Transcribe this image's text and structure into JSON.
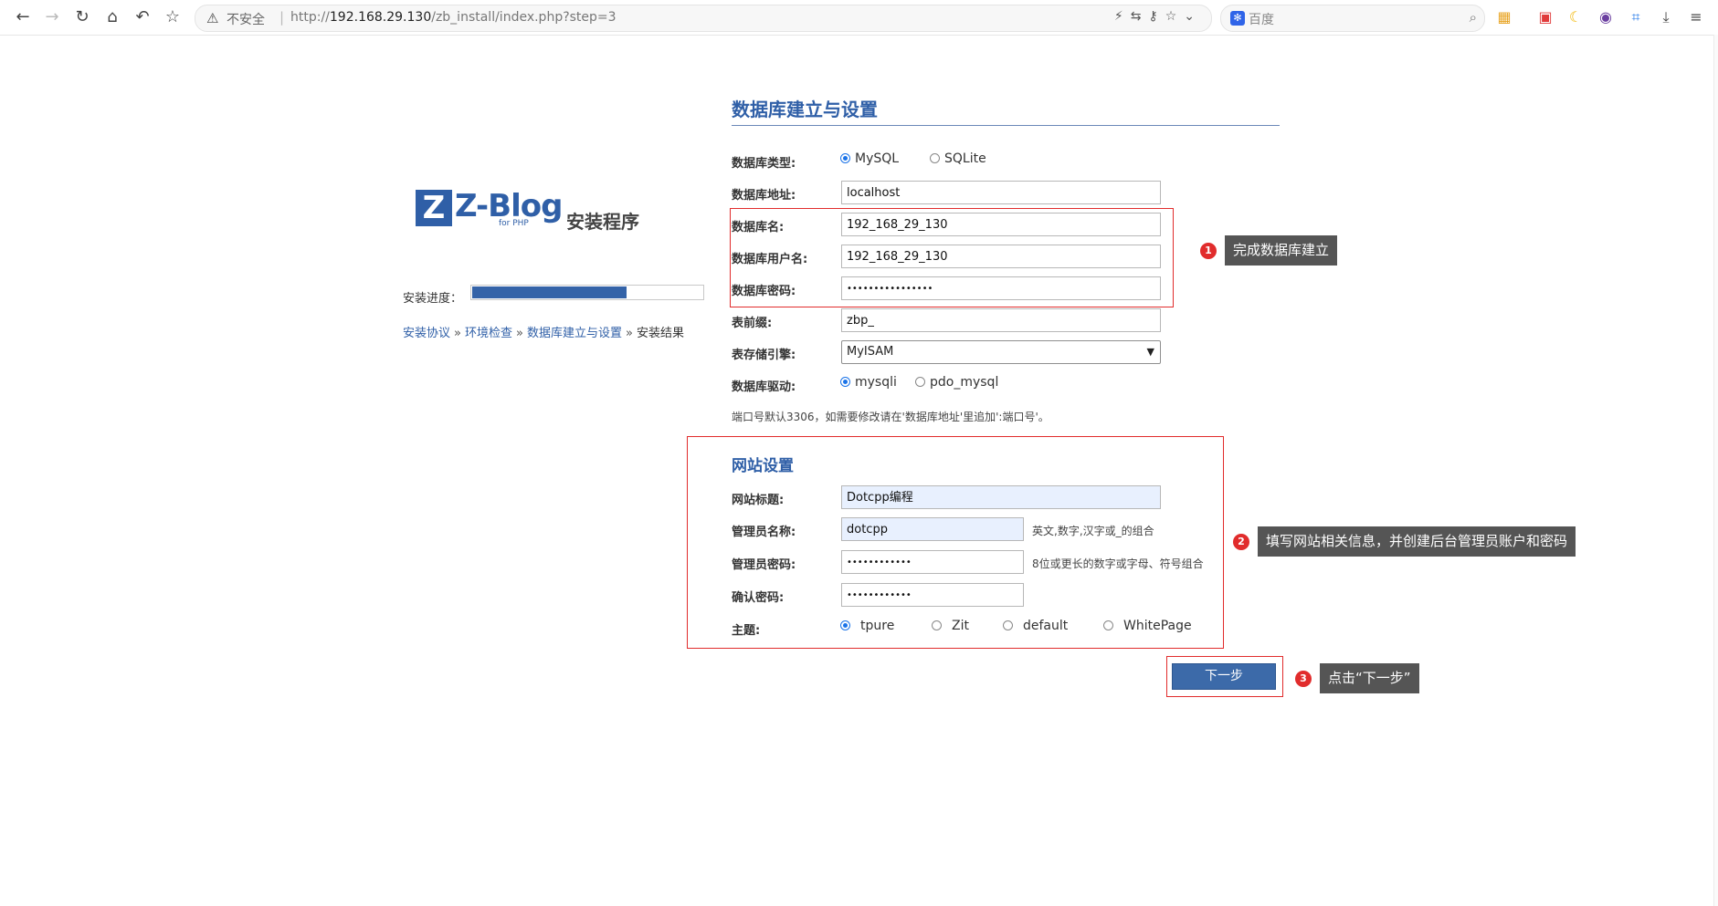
{
  "browser": {
    "insecure_label": "不安全",
    "url_prefix": "http://",
    "url_host": "192.168.29.130",
    "url_path": "/zb_install/index.php?step=3",
    "search_placeholder": "百度"
  },
  "brand": {
    "logo_letter": "Z",
    "logo_word": "Z-Blog",
    "logo_sub": "for PHP",
    "installer_label": "安装程序"
  },
  "progress": {
    "label": "安装进度：",
    "fraction": 0.67
  },
  "steps": {
    "items": [
      "安装协议",
      "环境检查",
      "数据库建立与设置",
      "安装结果"
    ],
    "separator": "»"
  },
  "db": {
    "heading": "数据库建立与设置",
    "type_label": "数据库类型:",
    "type_options": [
      "MySQL",
      "SQLite"
    ],
    "host_label": "数据库地址:",
    "host_value": "localhost",
    "name_label": "数据库名:",
    "name_value": "192_168_29_130",
    "user_label": "数据库用户名:",
    "user_value": "192_168_29_130",
    "password_label": "数据库密码:",
    "password_value": "••••••••••••••••",
    "prefix_label": "表前缀:",
    "prefix_value": "zbp_",
    "engine_label": "表存储引擎:",
    "engine_value": "MyISAM",
    "driver_label": "数据库驱动:",
    "driver_options": [
      "mysqli",
      "pdo_mysql"
    ],
    "port_note": "端口号默认3306，如需要修改请在'数据库地址'里追加':端口号'。"
  },
  "site": {
    "heading": "网站设置",
    "title_label": "网站标题:",
    "title_value": "Dotcpp编程",
    "admin_label": "管理员名称:",
    "admin_value": "dotcpp",
    "admin_hint": "英文,数字,汉字或_的组合",
    "password_label": "管理员密码:",
    "password_value": "••••••••••••",
    "password_hint": "8位或更长的数字或字母、符号组合",
    "confirm_label": "确认密码:",
    "confirm_value": "••••••••••••",
    "theme_label": "主题:",
    "theme_options": [
      "tpure",
      "Zit",
      "default",
      "WhitePage"
    ]
  },
  "actions": {
    "next_label": "下一步"
  },
  "annotations": [
    {
      "number": "1",
      "text": "完成数据库建立"
    },
    {
      "number": "2",
      "text": "填写网站相关信息，并创建后台管理员账户和密码"
    },
    {
      "number": "3",
      "text": "点击“下一步”"
    }
  ],
  "colors": {
    "brand_blue": "#2f5fa7",
    "annotation_red": "#e12c2c",
    "callout_bg": "#555555"
  }
}
